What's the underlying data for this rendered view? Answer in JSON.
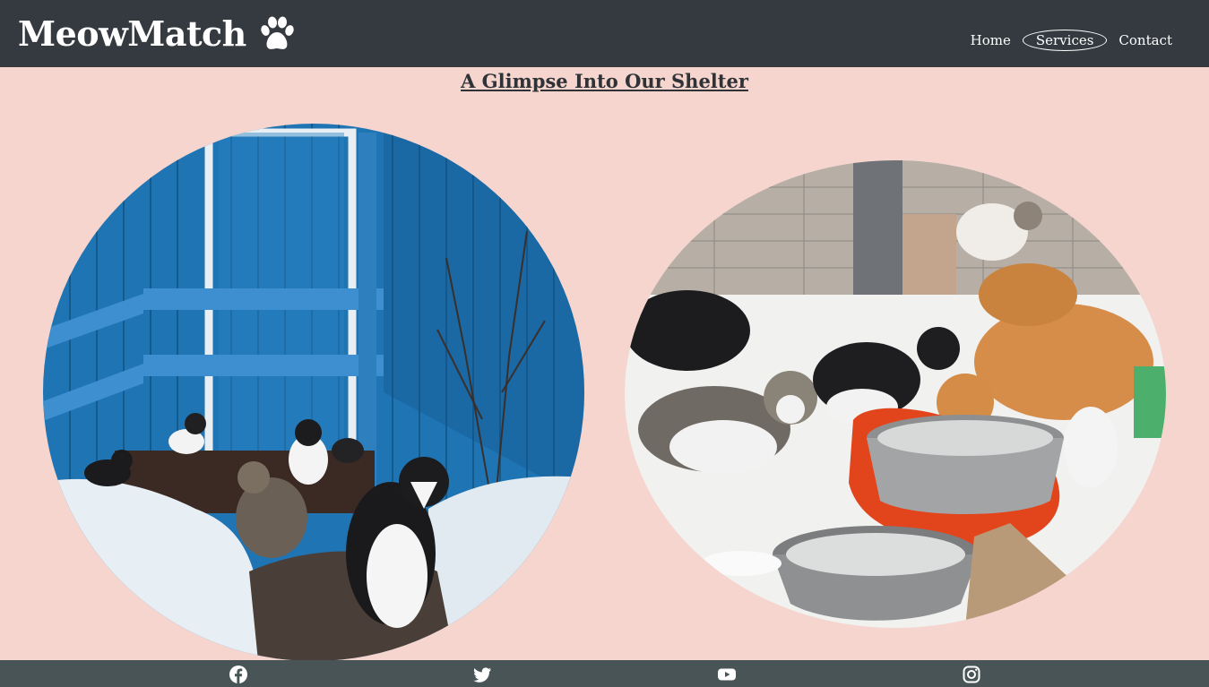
{
  "header": {
    "brand": "MeowMatch",
    "brand_icon": "paw-icon",
    "nav": [
      {
        "label": "Home",
        "active": false
      },
      {
        "label": "Services",
        "active": true
      },
      {
        "label": "Contact",
        "active": false
      }
    ]
  },
  "main": {
    "title": "A Glimpse Into Our Shelter",
    "photos": [
      {
        "name": "cats-by-blue-door"
      },
      {
        "name": "cats-eating-at-shelter"
      }
    ]
  },
  "footer": {
    "social": [
      "facebook-icon",
      "twitter-icon",
      "youtube-icon",
      "instagram-icon"
    ]
  },
  "colors": {
    "navbar": "#343a40",
    "background": "#f5d5cd",
    "footer": "#495456",
    "title": "#2f3236"
  }
}
